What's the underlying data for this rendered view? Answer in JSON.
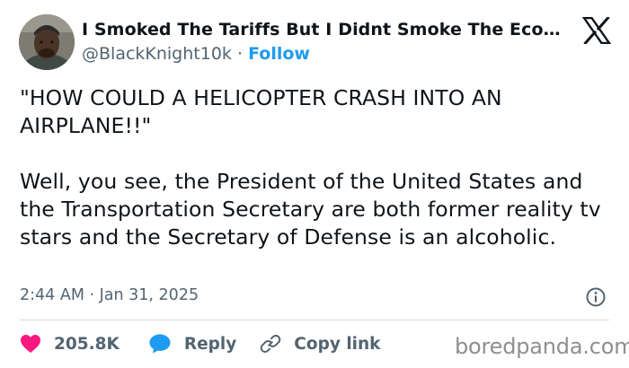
{
  "author": {
    "display_name": "I Smoked The Tariffs But I Didnt Smoke The Economy",
    "handle": "@BlackKnight10k",
    "separator": "·",
    "follow_label": "Follow",
    "avatar_icon": "profile-photo"
  },
  "platform_logo": "x-logo",
  "tweet": {
    "paragraphs": [
      "\"HOW COULD A HELICOPTER CRASH INTO AN AIRPLANE!!\"",
      "Well, you see, the President of the United States and the Transportation Secretary are both former reality tv stars and the Secretary of Defense is an alcoholic."
    ],
    "timestamp": "2:44 AM · Jan 31, 2025"
  },
  "actions": {
    "like_count": "205.8K",
    "reply_label": "Reply",
    "copy_link_label": "Copy link"
  },
  "watermark": "boredpanda.com",
  "colors": {
    "text": "#0f1419",
    "secondary": "#536471",
    "link_blue": "#1d9bf0",
    "like_pink": "#f91880",
    "reply_blue": "#1d9bf0",
    "divider": "#cfd9de",
    "watermark": "#8d8f91"
  }
}
